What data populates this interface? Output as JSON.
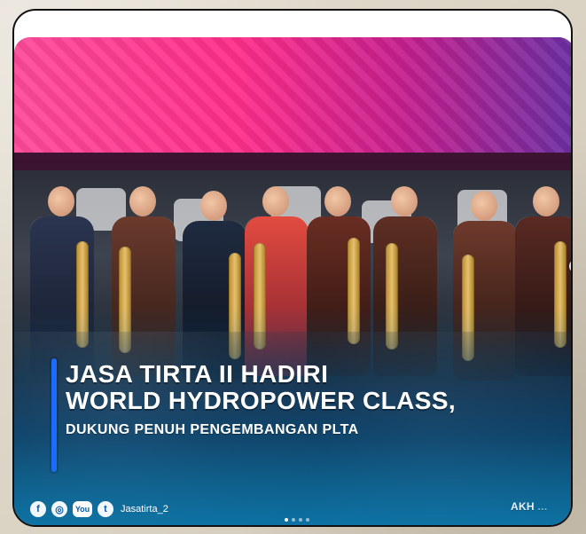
{
  "post": {
    "headline_line1": "JASA TIRTA II HADIRI",
    "headline_line2": "WORLD HYDROPOWER CLASS,",
    "subheadline": "DUKUNG PENUH PENGEMBANGAN PLTA"
  },
  "footer": {
    "social_icons": [
      "facebook-icon",
      "instagram-icon",
      "youtube-icon",
      "twitter-icon"
    ],
    "youtube_text": "You",
    "handle": "Jasatirta_2",
    "corner_text_main": "AKH",
    "corner_text_faint": "..."
  },
  "carousel": {
    "dots_count": 4,
    "active_index": 0
  },
  "colors": {
    "accent_bar": "#1b6bff",
    "overlay_blue": "#0a82b9",
    "led_pink": "#ff2e8a"
  }
}
